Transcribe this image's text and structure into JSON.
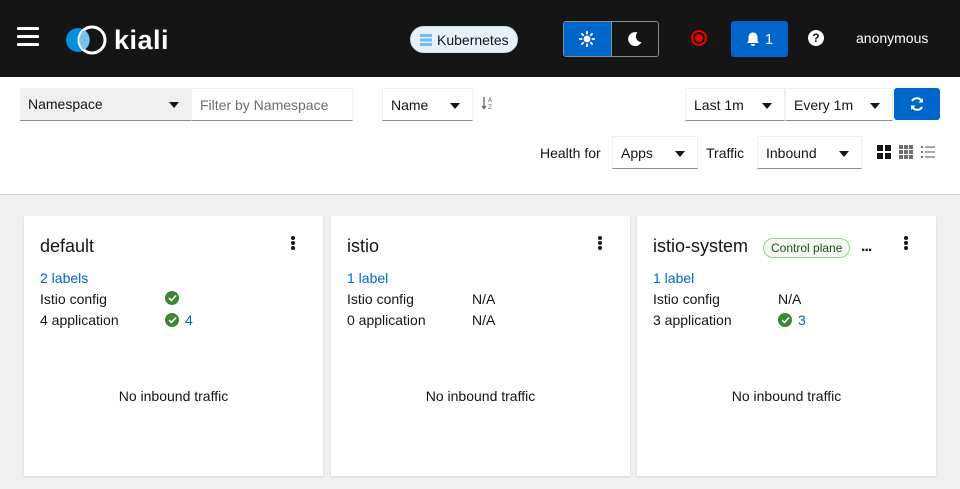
{
  "header": {
    "logo_text": "kiali",
    "cluster_label": "Kubernetes",
    "notifications_count": "1",
    "help_label": "?",
    "user": "anonymous"
  },
  "toolbar": {
    "namespace_select": "Namespace",
    "filter_placeholder": "Filter by Namespace",
    "sort_select": "Name",
    "time_range": "Last 1m",
    "refresh_interval": "Every 1m",
    "health_label": "Health for",
    "health_select": "Apps",
    "traffic_label": "Traffic",
    "traffic_select": "Inbound"
  },
  "cards": [
    {
      "title": "default",
      "labels": "2 labels",
      "istio_config_label": "Istio config",
      "apps_label": "4 application",
      "apps_count": "4",
      "traffic": "No inbound traffic"
    },
    {
      "title": "istio",
      "labels": "1 label",
      "istio_config_label": "Istio config",
      "istio_config_value": "N/A",
      "apps_label": "0 application",
      "apps_value": "N/A",
      "traffic": "No inbound traffic"
    },
    {
      "title": "istio-system",
      "badge": "Control plane",
      "more": "...",
      "labels": "1 label",
      "istio_config_label": "Istio config",
      "istio_config_value": "N/A",
      "apps_label": "3 application",
      "apps_count": "3",
      "traffic": "No inbound traffic"
    }
  ],
  "colors": {
    "masthead": "#151515",
    "primary": "#0066cc",
    "success": "#3e8635",
    "record": "#ee0000"
  }
}
